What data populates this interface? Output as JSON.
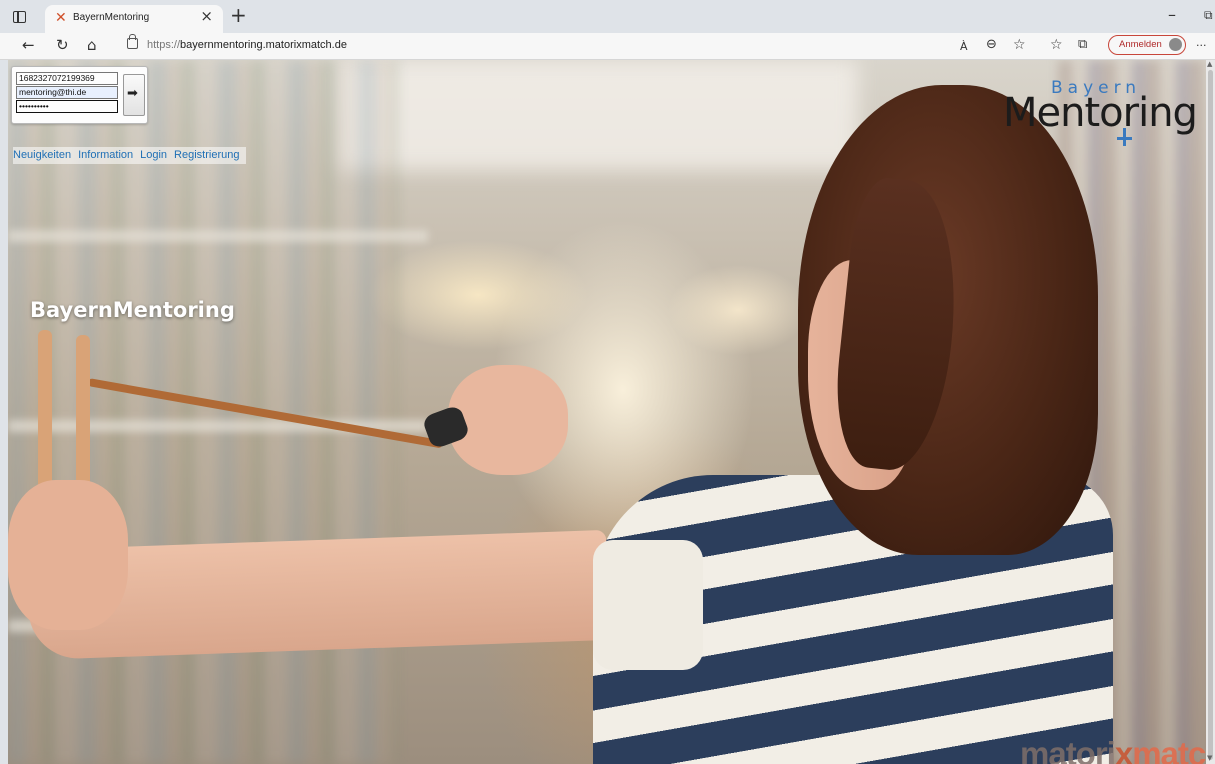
{
  "browser": {
    "tab": {
      "title": "BayernMentoring",
      "close": "×"
    },
    "new_tab": "+",
    "window": {
      "minimize": "–",
      "restore": "⧉"
    },
    "toolbar": {
      "back": "←",
      "reload": "↻",
      "home": "⌂",
      "url_protocol": "https://",
      "url_host": "bayernmentoring.matorixmatch.de",
      "read_aloud": "À",
      "zoom": "⊖",
      "favorite": "☆",
      "favorites": "☆",
      "collections": "⧉",
      "more": "···",
      "profile_label": "Anmelden"
    }
  },
  "login": {
    "id_value": "1682327072199369",
    "email_value": "mentoring@thi.de",
    "password_value": "••••••••••",
    "submit_icon": "➡"
  },
  "nav": {
    "items": [
      {
        "label": "Neuigkeiten"
      },
      {
        "label": "Information"
      },
      {
        "label": "Login"
      },
      {
        "label": "Registrierung"
      }
    ]
  },
  "logo": {
    "small": "Bayern",
    "large": "Mentoring"
  },
  "hero": {
    "title": "BayernMentoring"
  },
  "footer_brand": {
    "part1": "matori",
    "x": "x",
    "part2": "match"
  }
}
